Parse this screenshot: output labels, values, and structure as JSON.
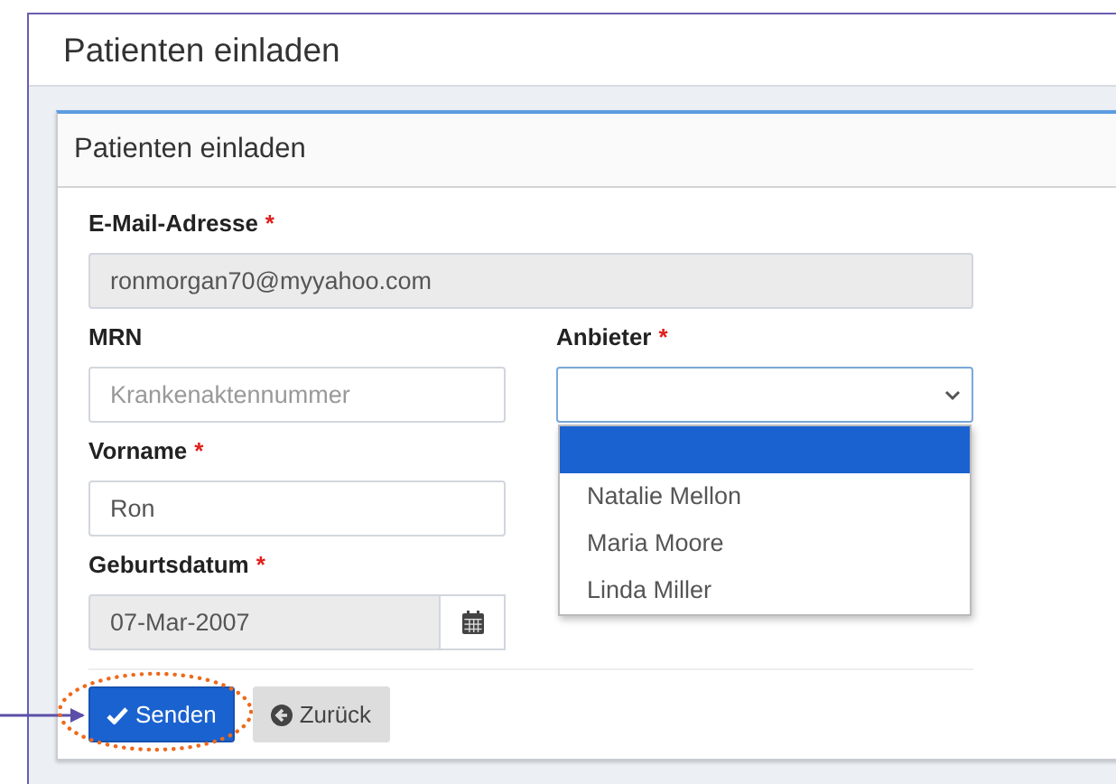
{
  "page": {
    "title": "Patienten einladen"
  },
  "card": {
    "title": "Patienten einladen",
    "email": {
      "label": "E-Mail-Adresse",
      "required_mark": "*",
      "value": "ronmorgan70@myyahoo.com",
      "disabled": true
    },
    "fields": [
      {
        "kind": "text",
        "label": "MRN",
        "placeholder": "Krankenaktennummer",
        "disabled": false
      },
      {
        "kind": "select",
        "label": "Anbieter",
        "required_mark": "*",
        "expanded": true,
        "options": [
          {
            "selected": true
          },
          {
            "label": "Natalie Mellon",
            "selected": false
          },
          {
            "label": "Maria Moore",
            "selected": false
          },
          {
            "label": "Linda Miller",
            "selected": false
          }
        ]
      },
      {
        "kind": "text",
        "label": "Vorname",
        "required_mark": "*",
        "value": "Ron",
        "disabled": false
      },
      {
        "kind": "date",
        "label": "Geburtsdatum",
        "required_mark": "*",
        "value": "07-Mar-2007",
        "disabled": true
      }
    ],
    "buttons": [
      {
        "kind": "primary",
        "label": "Senden",
        "highlighted": true
      },
      {
        "kind": "default",
        "label": "Zurück",
        "highlighted": false
      }
    ]
  }
}
